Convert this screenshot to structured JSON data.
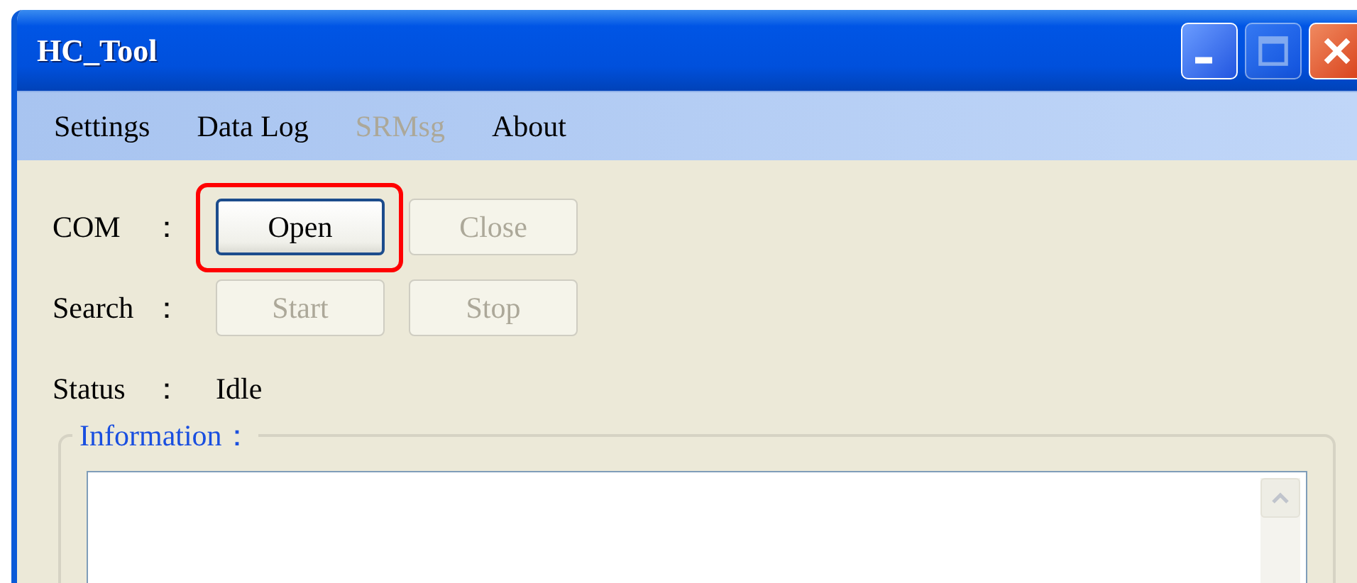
{
  "window": {
    "title": "HC_Tool",
    "controls": [
      {
        "kind": "minimize",
        "disabled": false
      },
      {
        "kind": "maximize",
        "disabled": true
      },
      {
        "kind": "close",
        "disabled": false
      }
    ]
  },
  "menu": [
    {
      "label": "Settings",
      "disabled": false
    },
    {
      "label": "Data Log",
      "disabled": false
    },
    {
      "label": "SRMsg",
      "disabled": true
    },
    {
      "label": "About",
      "disabled": false
    }
  ],
  "rows": [
    {
      "kind": "buttons",
      "label": "COM",
      "colon": "：",
      "buttons": [
        {
          "label": "Open",
          "disabled": false,
          "focused": true,
          "highlighted": true
        },
        {
          "label": "Close",
          "disabled": true,
          "focused": false,
          "highlighted": false
        }
      ]
    },
    {
      "kind": "buttons",
      "label": "Search",
      "colon": "：",
      "buttons": [
        {
          "label": "Start",
          "disabled": true,
          "focused": false,
          "highlighted": false
        },
        {
          "label": "Stop",
          "disabled": true,
          "focused": false,
          "highlighted": false
        }
      ]
    },
    {
      "kind": "value",
      "label": "Status",
      "colon": "：",
      "value": "Idle"
    }
  ],
  "information": {
    "title": "Information："
  }
}
